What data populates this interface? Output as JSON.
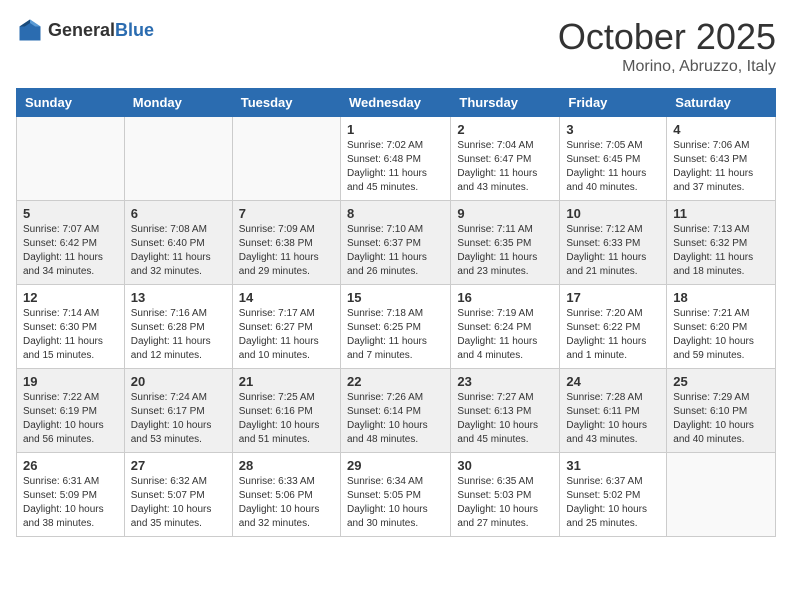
{
  "header": {
    "logo": {
      "general": "General",
      "blue": "Blue"
    },
    "title": "October 2025",
    "subtitle": "Morino, Abruzzo, Italy"
  },
  "weekdays": [
    "Sunday",
    "Monday",
    "Tuesday",
    "Wednesday",
    "Thursday",
    "Friday",
    "Saturday"
  ],
  "weeks": [
    [
      {
        "day": "",
        "info": ""
      },
      {
        "day": "",
        "info": ""
      },
      {
        "day": "",
        "info": ""
      },
      {
        "day": "1",
        "info": "Sunrise: 7:02 AM\nSunset: 6:48 PM\nDaylight: 11 hours and 45 minutes."
      },
      {
        "day": "2",
        "info": "Sunrise: 7:04 AM\nSunset: 6:47 PM\nDaylight: 11 hours and 43 minutes."
      },
      {
        "day": "3",
        "info": "Sunrise: 7:05 AM\nSunset: 6:45 PM\nDaylight: 11 hours and 40 minutes."
      },
      {
        "day": "4",
        "info": "Sunrise: 7:06 AM\nSunset: 6:43 PM\nDaylight: 11 hours and 37 minutes."
      }
    ],
    [
      {
        "day": "5",
        "info": "Sunrise: 7:07 AM\nSunset: 6:42 PM\nDaylight: 11 hours and 34 minutes."
      },
      {
        "day": "6",
        "info": "Sunrise: 7:08 AM\nSunset: 6:40 PM\nDaylight: 11 hours and 32 minutes."
      },
      {
        "day": "7",
        "info": "Sunrise: 7:09 AM\nSunset: 6:38 PM\nDaylight: 11 hours and 29 minutes."
      },
      {
        "day": "8",
        "info": "Sunrise: 7:10 AM\nSunset: 6:37 PM\nDaylight: 11 hours and 26 minutes."
      },
      {
        "day": "9",
        "info": "Sunrise: 7:11 AM\nSunset: 6:35 PM\nDaylight: 11 hours and 23 minutes."
      },
      {
        "day": "10",
        "info": "Sunrise: 7:12 AM\nSunset: 6:33 PM\nDaylight: 11 hours and 21 minutes."
      },
      {
        "day": "11",
        "info": "Sunrise: 7:13 AM\nSunset: 6:32 PM\nDaylight: 11 hours and 18 minutes."
      }
    ],
    [
      {
        "day": "12",
        "info": "Sunrise: 7:14 AM\nSunset: 6:30 PM\nDaylight: 11 hours and 15 minutes."
      },
      {
        "day": "13",
        "info": "Sunrise: 7:16 AM\nSunset: 6:28 PM\nDaylight: 11 hours and 12 minutes."
      },
      {
        "day": "14",
        "info": "Sunrise: 7:17 AM\nSunset: 6:27 PM\nDaylight: 11 hours and 10 minutes."
      },
      {
        "day": "15",
        "info": "Sunrise: 7:18 AM\nSunset: 6:25 PM\nDaylight: 11 hours and 7 minutes."
      },
      {
        "day": "16",
        "info": "Sunrise: 7:19 AM\nSunset: 6:24 PM\nDaylight: 11 hours and 4 minutes."
      },
      {
        "day": "17",
        "info": "Sunrise: 7:20 AM\nSunset: 6:22 PM\nDaylight: 11 hours and 1 minute."
      },
      {
        "day": "18",
        "info": "Sunrise: 7:21 AM\nSunset: 6:20 PM\nDaylight: 10 hours and 59 minutes."
      }
    ],
    [
      {
        "day": "19",
        "info": "Sunrise: 7:22 AM\nSunset: 6:19 PM\nDaylight: 10 hours and 56 minutes."
      },
      {
        "day": "20",
        "info": "Sunrise: 7:24 AM\nSunset: 6:17 PM\nDaylight: 10 hours and 53 minutes."
      },
      {
        "day": "21",
        "info": "Sunrise: 7:25 AM\nSunset: 6:16 PM\nDaylight: 10 hours and 51 minutes."
      },
      {
        "day": "22",
        "info": "Sunrise: 7:26 AM\nSunset: 6:14 PM\nDaylight: 10 hours and 48 minutes."
      },
      {
        "day": "23",
        "info": "Sunrise: 7:27 AM\nSunset: 6:13 PM\nDaylight: 10 hours and 45 minutes."
      },
      {
        "day": "24",
        "info": "Sunrise: 7:28 AM\nSunset: 6:11 PM\nDaylight: 10 hours and 43 minutes."
      },
      {
        "day": "25",
        "info": "Sunrise: 7:29 AM\nSunset: 6:10 PM\nDaylight: 10 hours and 40 minutes."
      }
    ],
    [
      {
        "day": "26",
        "info": "Sunrise: 6:31 AM\nSunset: 5:09 PM\nDaylight: 10 hours and 38 minutes."
      },
      {
        "day": "27",
        "info": "Sunrise: 6:32 AM\nSunset: 5:07 PM\nDaylight: 10 hours and 35 minutes."
      },
      {
        "day": "28",
        "info": "Sunrise: 6:33 AM\nSunset: 5:06 PM\nDaylight: 10 hours and 32 minutes."
      },
      {
        "day": "29",
        "info": "Sunrise: 6:34 AM\nSunset: 5:05 PM\nDaylight: 10 hours and 30 minutes."
      },
      {
        "day": "30",
        "info": "Sunrise: 6:35 AM\nSunset: 5:03 PM\nDaylight: 10 hours and 27 minutes."
      },
      {
        "day": "31",
        "info": "Sunrise: 6:37 AM\nSunset: 5:02 PM\nDaylight: 10 hours and 25 minutes."
      },
      {
        "day": "",
        "info": ""
      }
    ]
  ]
}
